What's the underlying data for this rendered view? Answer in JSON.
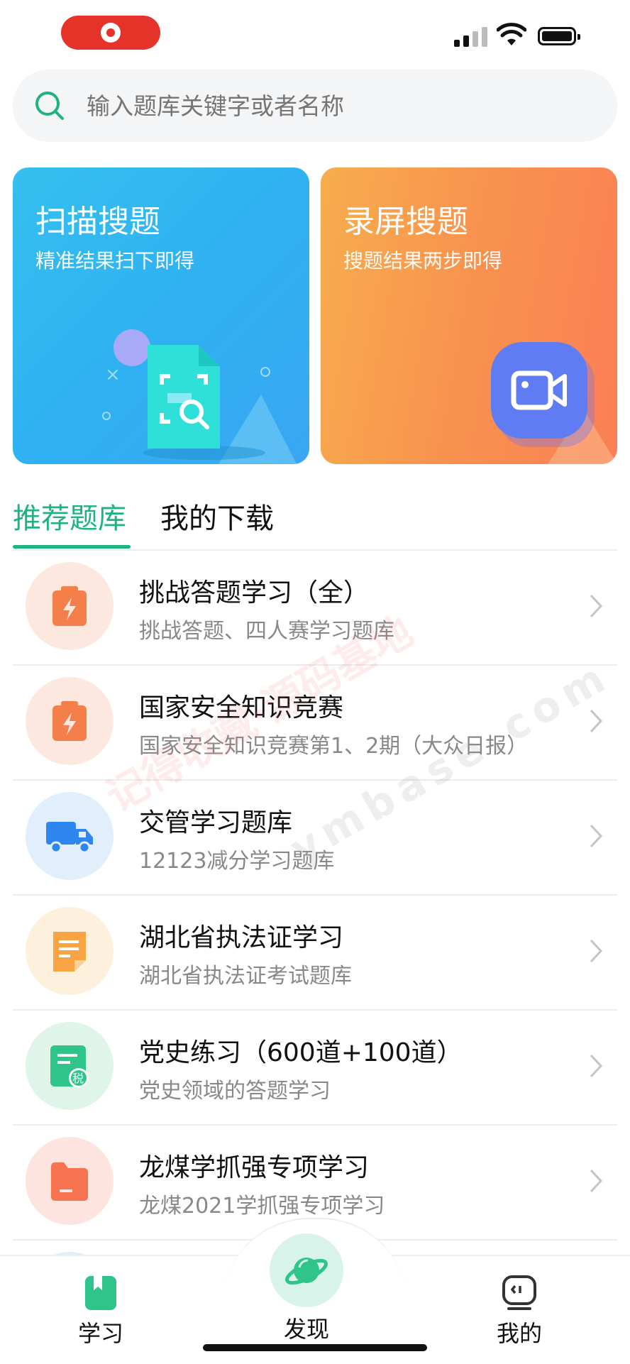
{
  "search": {
    "placeholder": "输入题库关键字或者名称"
  },
  "cards": [
    {
      "title": "扫描搜题",
      "subtitle": "精准结果扫下即得"
    },
    {
      "title": "录屏搜题",
      "subtitle": "搜题结果两步即得"
    }
  ],
  "tabs": {
    "active": "推荐题库",
    "inactive": "我的下载"
  },
  "list": [
    {
      "title": "挑战答题学习（全）",
      "subtitle": "挑战答题、四人赛学习题库",
      "icon": "clipboard-bolt-icon"
    },
    {
      "title": "国家安全知识竞赛",
      "subtitle": "国家安全知识竞赛第1、2期（大众日报）",
      "icon": "clipboard-bolt-icon"
    },
    {
      "title": "交管学习题库",
      "subtitle": "12123减分学习题库",
      "icon": "truck-icon"
    },
    {
      "title": "湖北省执法证学习",
      "subtitle": "湖北省执法证考试题库",
      "icon": "document-icon"
    },
    {
      "title": "党史练习（600道+100道）",
      "subtitle": "党史领域的答题学习",
      "icon": "tax-document-icon"
    },
    {
      "title": "龙煤学抓强专项学习",
      "subtitle": "龙煤2021学抓强专项学习",
      "icon": "folder-icon"
    }
  ],
  "watermark": {
    "line1": "记得收藏·源码基地",
    "line2": "ymbase.com"
  },
  "nav": {
    "study": "学习",
    "discover": "发现",
    "mine": "我的"
  },
  "colors": {
    "accent": "#1fb380",
    "record": "#e63329"
  }
}
